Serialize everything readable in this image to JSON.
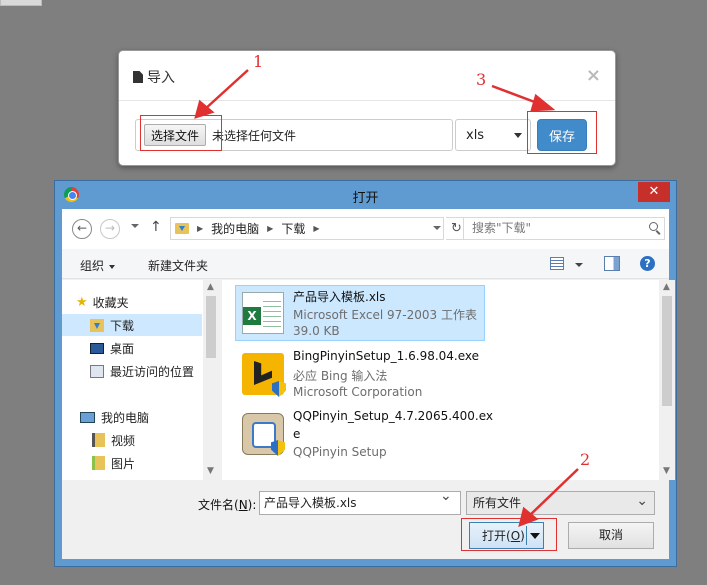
{
  "import_modal": {
    "title": "导入",
    "close_glyph": "×",
    "choose_file_label": "选择文件",
    "no_file_text": "未选择任何文件",
    "format_value": "xls",
    "save_label": "保存"
  },
  "annotations": {
    "n1": "1",
    "n2": "2",
    "n3": "3",
    "color": "#e03030"
  },
  "open_dialog": {
    "title": "打开",
    "close_glyph": "✕",
    "back_glyph": "←",
    "forward_glyph": "→",
    "up_glyph": "↑",
    "refresh_glyph": "↻",
    "path": [
      "我的电脑",
      "下载"
    ],
    "search_placeholder": "搜索\"下载\"",
    "toolbar": {
      "organize": "组织",
      "new_folder": "新建文件夹",
      "help_glyph": "?"
    },
    "nav_items": [
      {
        "label": "收藏夹"
      },
      {
        "label": "下载"
      },
      {
        "label": "桌面"
      },
      {
        "label": "最近访问的位置"
      },
      {
        "label": "我的电脑"
      },
      {
        "label": "视频"
      },
      {
        "label": "图片"
      }
    ],
    "files": [
      {
        "name": "产品导入模板.xls",
        "line2": "Microsoft Excel 97-2003 工作表",
        "line3": "39.0 KB"
      },
      {
        "name": "BingPinyinSetup_1.6.98.04.exe",
        "line2": "必应 Bing 输入法",
        "line3": "Microsoft Corporation"
      },
      {
        "name": "QQPinyin_Setup_4.7.2065.400.ex",
        "line2": "e",
        "line3": "QQPinyin Setup"
      }
    ],
    "filename_label_pre": "文件名(",
    "filename_label_key": "N",
    "filename_label_post": "):",
    "filename_value": "产品导入模板.xls",
    "filetype_value": "所有文件",
    "open_label_pre": "打开(",
    "open_label_key": "O",
    "open_label_post": ")",
    "cancel_label": "取消"
  }
}
